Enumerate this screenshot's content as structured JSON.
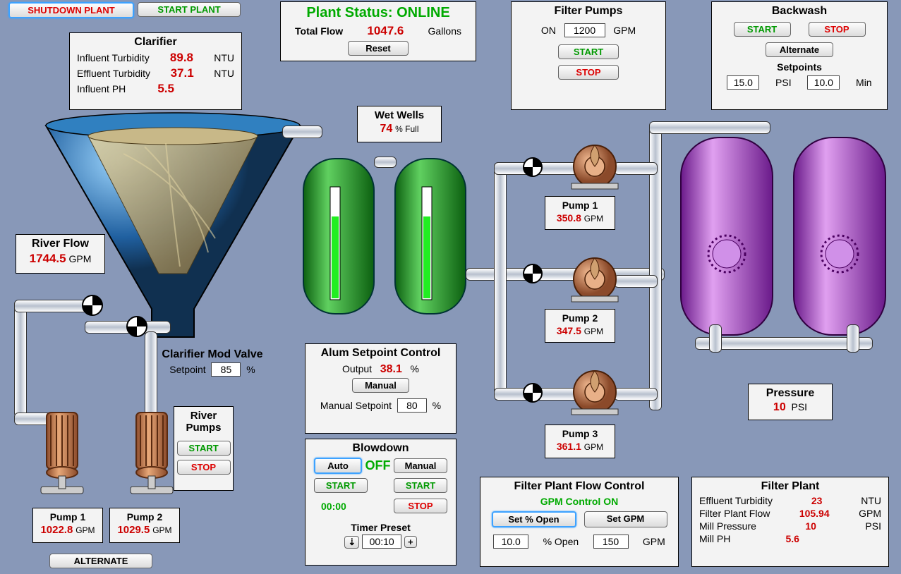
{
  "buttons": {
    "shutdown": "SHUTDOWN PLANT",
    "start_plant": "START PLANT",
    "reset": "Reset",
    "start": "START",
    "stop": "STOP",
    "alternate": "Alternate",
    "alternate_upper": "ALTERNATE",
    "manual": "Manual",
    "auto": "Auto",
    "set_open": "Set % Open",
    "set_gpm": "Set GPM"
  },
  "status": {
    "label": "Plant Status: ONLINE",
    "total_flow_label": "Total Flow",
    "total_flow": "1047.6",
    "total_flow_unit": "Gallons"
  },
  "clarifier": {
    "title": "Clarifier",
    "rows": [
      {
        "label": "Influent Turbidity",
        "value": "89.8",
        "unit": "NTU"
      },
      {
        "label": "Effluent Turbidity",
        "value": "37.1",
        "unit": "NTU"
      },
      {
        "label": "Influent PH",
        "value": "5.5",
        "unit": ""
      }
    ]
  },
  "river_flow": {
    "title": "River Flow",
    "value": "1744.5",
    "unit": "GPM"
  },
  "cmv": {
    "title": "Clarifier Mod Valve",
    "setpoint_label": "Setpoint",
    "setpoint": "85",
    "unit": "%"
  },
  "river_pumps": {
    "title": "River Pumps",
    "pump1": {
      "title": "Pump 1",
      "value": "1022.8",
      "unit": "GPM"
    },
    "pump2": {
      "title": "Pump 2",
      "value": "1029.5",
      "unit": "GPM"
    }
  },
  "wet_wells": {
    "title": "Wet Wells",
    "value": "74",
    "unit": "% Full"
  },
  "alum": {
    "title": "Alum Setpoint Control",
    "output_label": "Output",
    "output": "38.1",
    "unit": "%",
    "man_label": "Manual Setpoint",
    "man_value": "80"
  },
  "blowdown": {
    "title": "Blowdown",
    "status": "OFF",
    "timer": "00:00",
    "preset_label": "Timer Preset",
    "preset": "00:10"
  },
  "filter_pumps": {
    "title": "Filter Pumps",
    "on_label": "ON",
    "value": "1200",
    "unit": "GPM",
    "p1": {
      "title": "Pump 1",
      "value": "350.8",
      "unit": "GPM"
    },
    "p2": {
      "title": "Pump 2",
      "value": "347.5",
      "unit": "GPM"
    },
    "p3": {
      "title": "Pump 3",
      "value": "361.1",
      "unit": "GPM"
    }
  },
  "backwash": {
    "title": "Backwash",
    "setpoints_label": "Setpoints",
    "psi_value": "15.0",
    "psi_unit": "PSI",
    "min_value": "10.0",
    "min_unit": "Min"
  },
  "pressure": {
    "title": "Pressure",
    "value": "10",
    "unit": "PSI"
  },
  "fpc": {
    "title": "Filter Plant Flow Control",
    "mode": "GPM Control ON",
    "open_value": "10.0",
    "open_unit": "% Open",
    "gpm_value": "150",
    "gpm_unit": "GPM"
  },
  "filter_plant": {
    "title": "Filter Plant",
    "rows": [
      {
        "label": "Effluent Turbidity",
        "value": "23",
        "unit": "NTU"
      },
      {
        "label": "Filter Plant Flow",
        "value": "105.94",
        "unit": "GPM"
      },
      {
        "label": "Mill Pressure",
        "value": "10",
        "unit": "PSI"
      },
      {
        "label": "Mill PH",
        "value": "5.6",
        "unit": ""
      }
    ]
  }
}
